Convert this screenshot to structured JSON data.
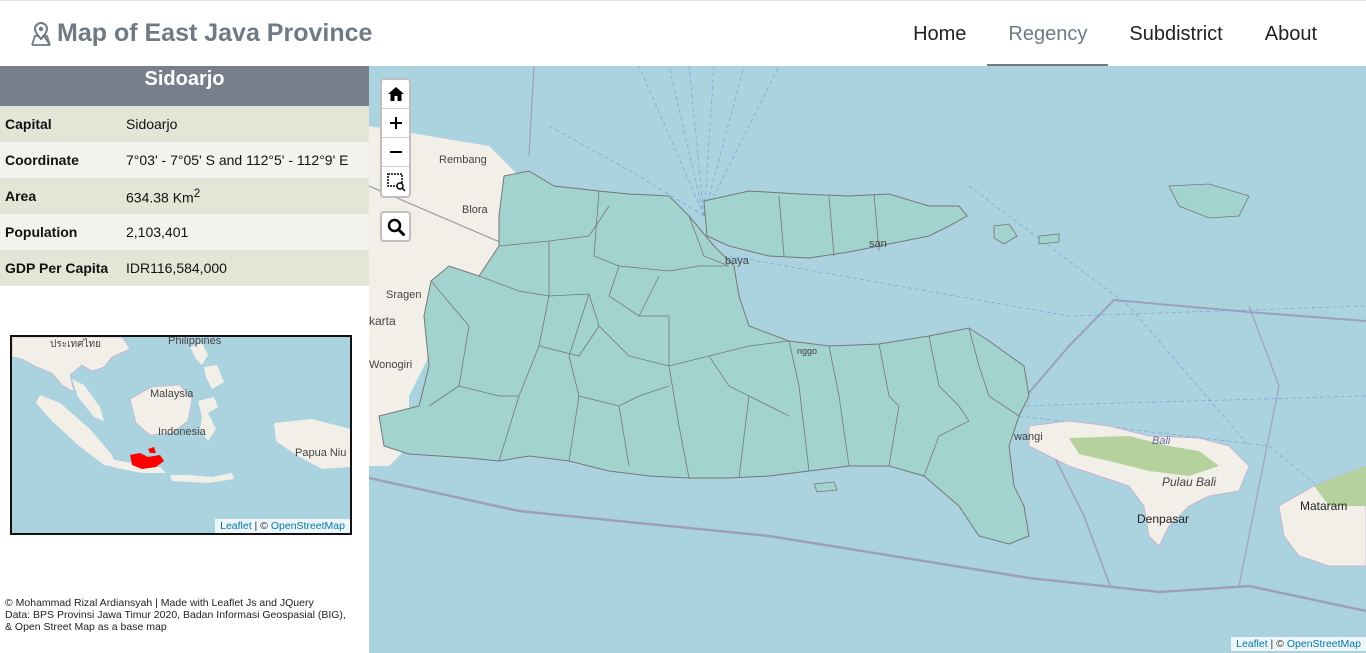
{
  "brand": {
    "title": "Map of East Java Province"
  },
  "nav": {
    "items": [
      {
        "label": "Home"
      },
      {
        "label": "Regency"
      },
      {
        "label": "Subdistrict"
      },
      {
        "label": "About"
      }
    ]
  },
  "info": {
    "title": "Sidoarjo",
    "rows": [
      {
        "key": "Capital",
        "value": "Sidoarjo"
      },
      {
        "key": "Coordinate",
        "value": "7°03' - 7°05' S and 112°5' - 112°9' E"
      },
      {
        "key": "Area",
        "value": "634.38 Km",
        "sup": "2"
      },
      {
        "key": "Population",
        "value": "2,103,401"
      },
      {
        "key": "GDP Per Capita",
        "value": "IDR116,584,000"
      }
    ]
  },
  "minimap": {
    "labels": {
      "thailand": "ประเทศไทย",
      "philippines": "Philippines",
      "malaysia": "Malaysia",
      "indonesia": "Indonesia",
      "papua": "Papua Niu"
    },
    "attribution": {
      "leaflet": "Leaflet",
      "sep": " | © ",
      "osm": "OpenStreetMap"
    }
  },
  "footer": {
    "line1": "© Mohammad Rizal Ardiansyah | Made with Leaflet Js and JQuery",
    "line2": "Data: BPS Provinsi Jawa Timur 2020, Badan Informasi Geospasial (BIG),",
    "line3": "& Open Street Map as a base map"
  },
  "map": {
    "labels": {
      "rembang": "Rembang",
      "blora": "Blora",
      "sragen": "Sragen",
      "karta": "karta",
      "wonogiri": "Wonogiri",
      "baya": "baya",
      "san": "san",
      "wangi": "wangi",
      "bali": "Bali",
      "pulau_bali": "Pulau Bali",
      "denpasar": "Denpasar",
      "mataram": "Mataram",
      "gg": "nggo"
    },
    "attribution": {
      "leaflet": "Leaflet",
      "sep": " | © ",
      "osm": "OpenStreetMap"
    }
  },
  "colors": {
    "accent": "#707a85",
    "region_fill": "#a3d3cf",
    "sea": "#aad3df",
    "highlight": "#ff0000"
  }
}
